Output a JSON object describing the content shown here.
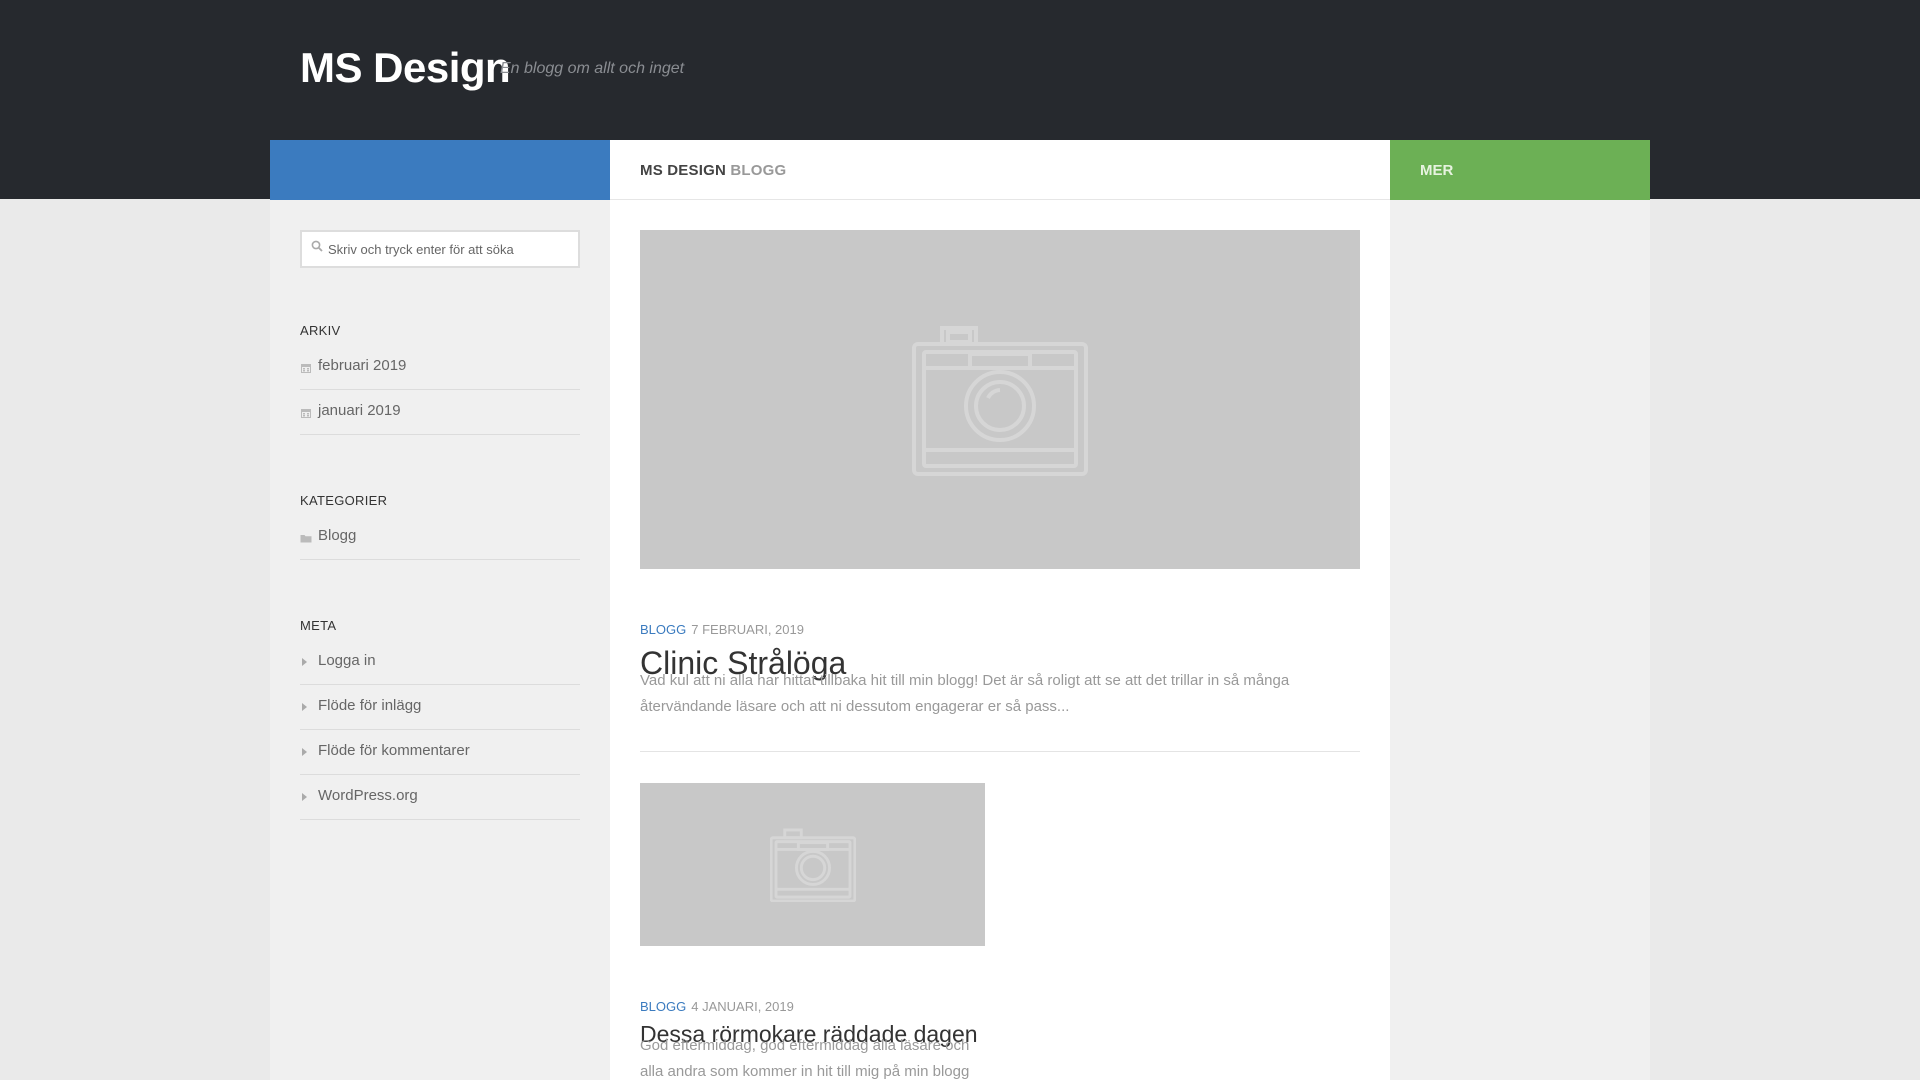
{
  "site": {
    "title": "MS Design",
    "tagline": "En blogg om allt och inget"
  },
  "page_title": {
    "main": "MS DESIGN",
    "sub": "BLOGG"
  },
  "right_bar": {
    "label": "MER"
  },
  "search": {
    "placeholder": "Skriv och tryck enter för att söka",
    "value": ""
  },
  "widgets": {
    "archive": {
      "title": "ARKIV",
      "items": [
        {
          "label": "februari 2019",
          "icon": "calendar-icon"
        },
        {
          "label": "januari 2019",
          "icon": "calendar-icon"
        }
      ]
    },
    "categories": {
      "title": "KATEGORIER",
      "items": [
        {
          "label": "Blogg",
          "icon": "folder-icon"
        }
      ]
    },
    "meta": {
      "title": "META",
      "items": [
        {
          "label": "Logga in",
          "icon": "triangle-right-icon"
        },
        {
          "label": "Flöde för inlägg",
          "icon": "triangle-right-icon"
        },
        {
          "label": "Flöde för kommentarer",
          "icon": "triangle-right-icon"
        },
        {
          "label": "WordPress.org",
          "icon": "triangle-right-icon"
        }
      ]
    }
  },
  "posts": [
    {
      "category": "BLOGG",
      "date": "7 FEBRUARI, 2019",
      "title": "Clinic Strålöga",
      "excerpt": "Vad kul att ni alla har hittat tillbaka hit till min blogg! Det är så roligt att se att det trillar in så många återvändande läsare och att ni dessutom engagerar er så pass..."
    },
    {
      "category": "BLOGG",
      "date": "4 JANUARI, 2019",
      "title": "Dessa rörmokare räddade dagen",
      "excerpt": "God eftermiddag, god eftermiddag alla läsare och alla andra som kommer in hit till mig på min blogg för att"
    }
  ],
  "colors": {
    "header_bg": "#26292e",
    "accent_blue": "#3b7bbf",
    "accent_green": "#6cb055",
    "thumb_placeholder": "#c8c8c8"
  }
}
